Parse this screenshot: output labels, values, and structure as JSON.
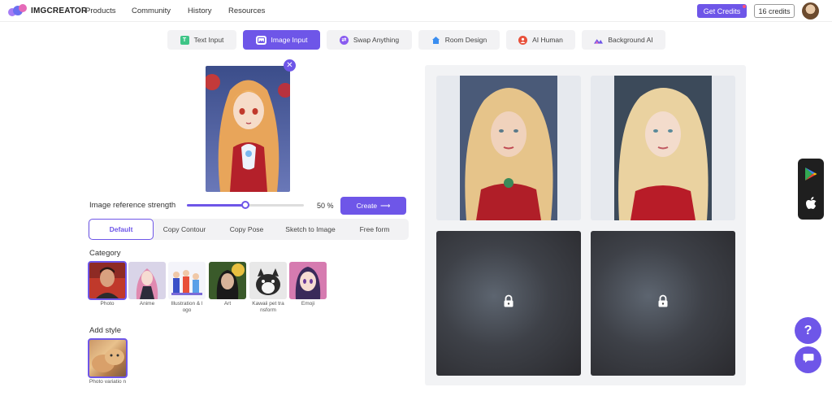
{
  "header": {
    "logo_text": "IMGCREATOR",
    "nav": [
      "Products",
      "Community",
      "History",
      "Resources"
    ],
    "get_credits": "Get Credits",
    "credits": "16 credits"
  },
  "tabs": [
    {
      "label": "Text Input",
      "icon": "text-icon",
      "active": false
    },
    {
      "label": "Image Input",
      "icon": "image-icon",
      "active": true
    },
    {
      "label": "Swap Anything",
      "icon": "swap-icon",
      "active": false
    },
    {
      "label": "Room Design",
      "icon": "house-icon",
      "active": false
    },
    {
      "label": "AI Human",
      "icon": "human-icon",
      "active": false
    },
    {
      "label": "Background AI",
      "icon": "mountain-icon",
      "active": false
    }
  ],
  "controls": {
    "strength_label": "Image reference strength",
    "strength_value_text": "50 %",
    "strength_value": 0.5,
    "create_label": "Create"
  },
  "modes": [
    "Default",
    "Copy Contour",
    "Copy Pose",
    "Sketch to Image",
    "Free form"
  ],
  "category": {
    "heading": "Category",
    "items": [
      "Photo",
      "Anime",
      "Illustration & l ogo",
      "Art",
      "Kawaii pet tra nsform",
      "Emoji"
    ]
  },
  "add_style": {
    "heading": "Add style",
    "items": [
      "Photo variatio n"
    ]
  },
  "accent_color": "#6e56e8"
}
